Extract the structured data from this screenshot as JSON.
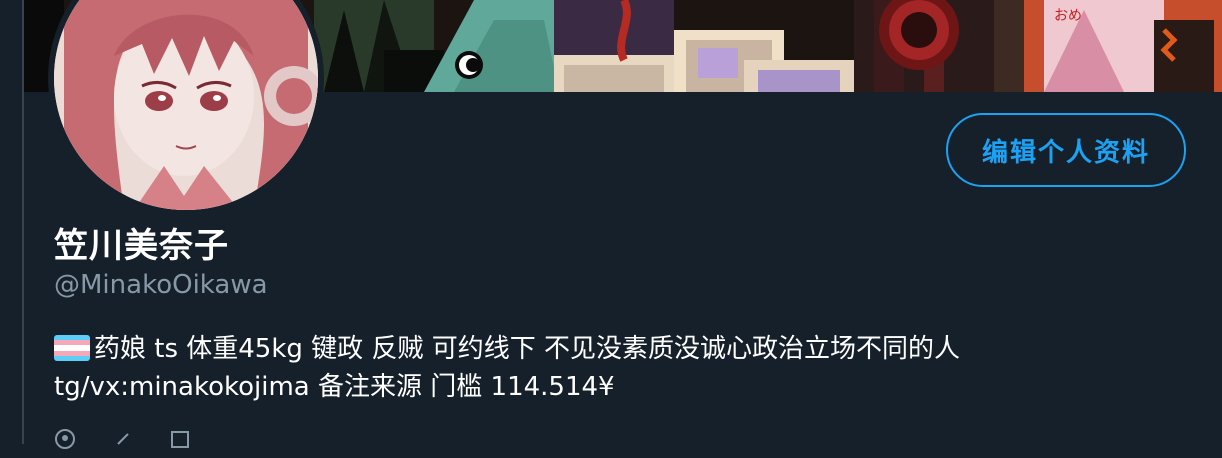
{
  "profile": {
    "display_name": "笠川美奈子",
    "handle": "@MinakoOikawa",
    "edit_button_label": "编辑个人资料",
    "bio_line1": "药娘 ts 体重45kg 键政 反贼 可约线下 不见没素质没诚心政治立场不同的人",
    "bio_line2": "tg/vx:minakokojima 备注来源 门槛 114.514¥",
    "bio_flag_icon": "transgender-flag-icon",
    "meta": {
      "location_icon": "location-pin-icon",
      "link_icon": "link-icon",
      "calendar_icon": "calendar-icon"
    }
  },
  "colors": {
    "background": "#15202b",
    "accent": "#1da1f2",
    "secondary_text": "#8899a6",
    "flag_blue": "#5bcefa",
    "flag_pink": "#f5a9b8",
    "flag_white": "#ffffff"
  }
}
